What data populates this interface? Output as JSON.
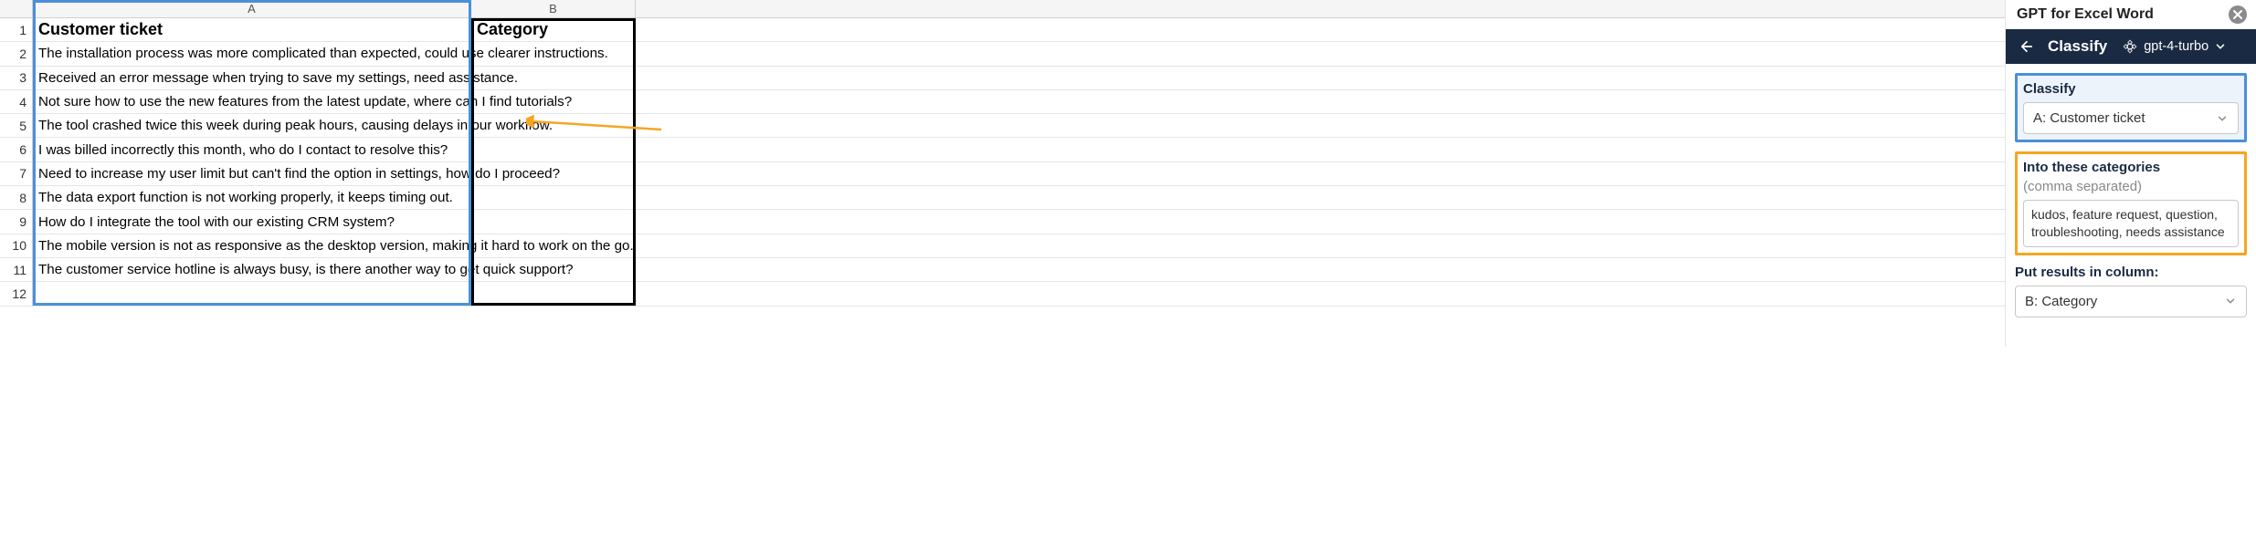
{
  "spreadsheet": {
    "columns": [
      {
        "letter": "A"
      },
      {
        "letter": "B"
      }
    ],
    "rows": [
      {
        "num": "1",
        "a": "Customer ticket",
        "b": "Category",
        "header": true
      },
      {
        "num": "2",
        "a": "The installation process was more complicated than expected, could use clearer instructions.",
        "b": ""
      },
      {
        "num": "3",
        "a": "Received an error message when trying to save my settings, need assistance.",
        "b": ""
      },
      {
        "num": "4",
        "a": "Not sure how to use the new features from the latest update, where can I find tutorials?",
        "b": ""
      },
      {
        "num": "5",
        "a": "The tool crashed twice this week during peak hours, causing delays in our workflow.",
        "b": ""
      },
      {
        "num": "6",
        "a": "I was billed incorrectly this month, who do I contact to resolve this?",
        "b": ""
      },
      {
        "num": "7",
        "a": "Need to increase my user limit but can't find the option in settings, how do I proceed?",
        "b": ""
      },
      {
        "num": "8",
        "a": "The data export function is not working properly, it keeps timing out.",
        "b": ""
      },
      {
        "num": "9",
        "a": "How do I integrate the tool with our existing CRM system?",
        "b": ""
      },
      {
        "num": "10",
        "a": "The mobile version is not as responsive as the desktop version, making it hard to work on the go.",
        "b": ""
      },
      {
        "num": "11",
        "a": "The customer service hotline is always busy, is there another way to get quick support?",
        "b": ""
      },
      {
        "num": "12",
        "a": "",
        "b": ""
      }
    ]
  },
  "sidebar": {
    "title": "GPT for Excel Word",
    "breadcrumb": {
      "title": "Classify",
      "model": "gpt-4-turbo"
    },
    "fields": {
      "classify": {
        "label": "Classify",
        "value": "A: Customer ticket"
      },
      "categories": {
        "label": "Into these categories",
        "hint": "(comma separated)",
        "value": "kudos, feature request, question, troubleshooting, needs assistance"
      },
      "results": {
        "label": "Put results in column:",
        "value": "B: Category"
      }
    }
  }
}
